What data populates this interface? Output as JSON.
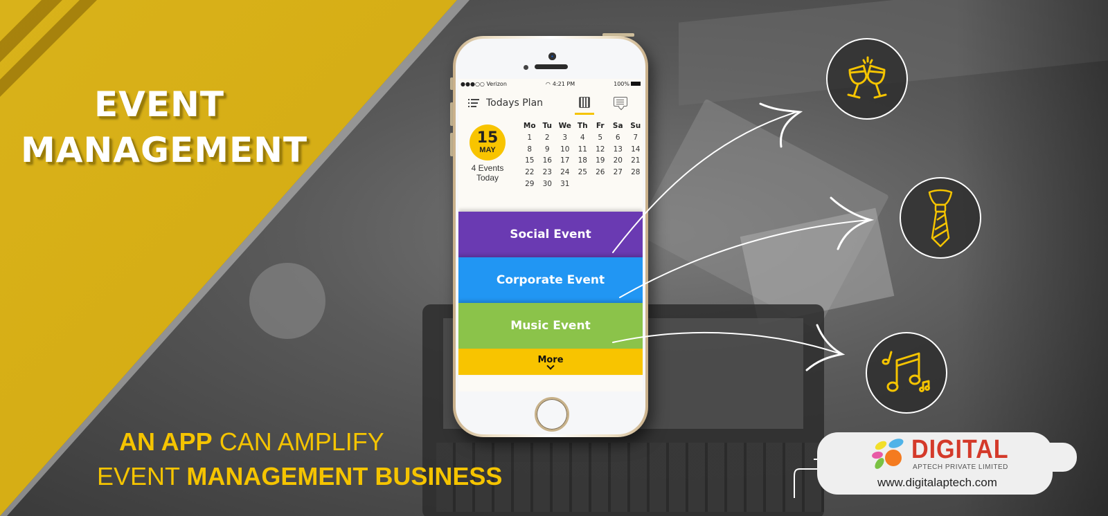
{
  "banner": {
    "headline": [
      "EVENT",
      "MANAGEMENT"
    ],
    "tagline_line1": {
      "bold": "AN APP",
      "regular": " CAN AMPLIFY"
    },
    "tagline_line2": {
      "regular": "EVENT ",
      "bold": "MANAGEMENT BUSINESS"
    },
    "accent_color": "#f5c400"
  },
  "phone": {
    "status_bar": {
      "carrier": "●●●○○ Verizon",
      "time": "4:21 PM",
      "battery": "100%",
      "wifi_icon": "wifi-icon"
    },
    "app_bar": {
      "title": "Todays Plan",
      "menu_icon": "list-menu-icon",
      "tabs": [
        {
          "icon": "calendar-icon",
          "active": true
        },
        {
          "icon": "message-icon",
          "active": false
        }
      ]
    },
    "today": {
      "day": "15",
      "month": "MAY",
      "events_line1": "4 Events",
      "events_line2": "Today"
    },
    "calendar": {
      "weekdays": [
        "Mo",
        "Tu",
        "We",
        "Th",
        "Fr",
        "Sa",
        "Su"
      ],
      "days": [
        "1",
        "2",
        "3",
        "4",
        "5",
        "6",
        "7",
        "8",
        "9",
        "10",
        "11",
        "12",
        "13",
        "14",
        "15",
        "16",
        "17",
        "18",
        "19",
        "20",
        "21",
        "22",
        "23",
        "24",
        "25",
        "26",
        "27",
        "28",
        "29",
        "30",
        "31"
      ]
    },
    "events": [
      {
        "label": "Social Event",
        "color": "#6a3ab2"
      },
      {
        "label": "Corporate Event",
        "color": "#2196f3"
      },
      {
        "label": "Music Event",
        "color": "#8bc34a"
      }
    ],
    "more": {
      "label": "More",
      "icon": "chevron-down-icon",
      "color": "#f8c400"
    }
  },
  "feature_icons": [
    {
      "name": "cheers-glasses-icon",
      "for": "Social Event"
    },
    {
      "name": "necktie-icon",
      "for": "Corporate Event"
    },
    {
      "name": "music-notes-icon",
      "for": "Music Event"
    }
  ],
  "brand": {
    "name": "DIGITAL",
    "subtitle": "APTECH PRIVATE LIMITED",
    "url": "www.digitalaptech.com",
    "color": "#d43a2a"
  }
}
